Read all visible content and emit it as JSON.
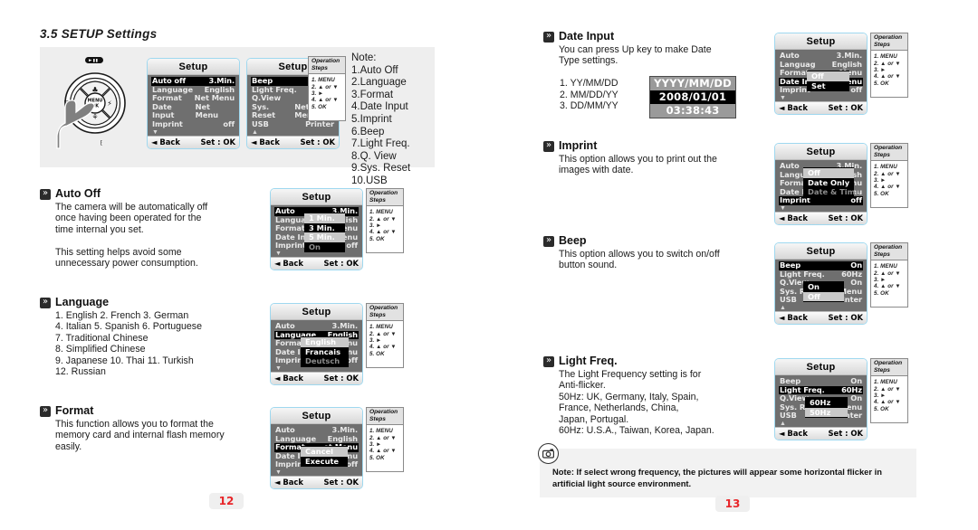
{
  "document": {
    "section_title": "3.5 SETUP Settings",
    "left_page_number": "12",
    "right_page_number": "13"
  },
  "ops_box": {
    "head_line1": "Operation",
    "head_line2": "Steps",
    "lines": [
      "1. MENU",
      "2. ▲ or ▼",
      "3. ►",
      "4. ▲ or ▼",
      "5. OK"
    ]
  },
  "lcd": {
    "title": "Setup",
    "back_label": "◄ Back",
    "set_label": "Set : OK",
    "down_arrow": "▼",
    "up_arrow": "▲"
  },
  "hero": {
    "note_heading": "Note:",
    "note_items": [
      "1.Auto Off",
      "2.Language",
      "3.Format",
      "4.Date Input",
      "5.Imprint",
      "6.Beep",
      "7.Light Freq.",
      "8.Q. View",
      "9.Sys. Reset",
      "10.USB"
    ],
    "screen_a": {
      "rows": [
        {
          "label": "Auto off",
          "value": "3.Min.",
          "selected": true
        },
        {
          "label": "Language",
          "value": "English",
          "selected": false
        },
        {
          "label": "Format",
          "value": "Net Menu",
          "selected": false
        },
        {
          "label": "Date Input",
          "value": "Net Menu",
          "selected": false
        },
        {
          "label": "Imprint",
          "value": "off",
          "selected": false
        }
      ],
      "scroll": "down"
    },
    "screen_b": {
      "rows": [
        {
          "label": "Beep",
          "value": "On",
          "selected": true
        },
        {
          "label": "Light Freq.",
          "value": "60Hz",
          "selected": false
        },
        {
          "label": "Q.View",
          "value": "On",
          "selected": false
        },
        {
          "label": "Sys. Reset",
          "value": "Net Menu",
          "selected": false
        },
        {
          "label": "USB",
          "value": "Printer",
          "selected": false
        }
      ],
      "scroll": "up"
    }
  },
  "sections": {
    "auto_off": {
      "title": "Auto Off",
      "body": "The camera will be automatically off\nonce having been operated for the\n time internal you set.\n\nThis setting helps avoid some\nunnecessary power consumption.",
      "rows": [
        {
          "label": "Auto",
          "value": "3.Min.",
          "selected": true
        },
        {
          "label": "Langua",
          "value": "nglish",
          "selected": false
        },
        {
          "label": "Format",
          "value": " Menu",
          "selected": false
        },
        {
          "label": "Date In",
          "value": "Menu",
          "selected": false
        },
        {
          "label": "Imprint",
          "value": "off",
          "selected": false
        }
      ],
      "submenu": [
        {
          "text": "1 Min.",
          "state": "hl"
        },
        {
          "text": "3 Min.",
          "state": "on"
        },
        {
          "text": "5 Min.",
          "state": "hl"
        },
        {
          "text": "On",
          "state": "dim"
        }
      ]
    },
    "language": {
      "title": "Language",
      "body": "1. English  2. French    3. German\n4. Italian     5. Spanish  6. Portuguese\n7. Traditional Chinese\n8. Simplified Chinese\n9. Japanese   10. Thai  11. Turkish\n12. Russian",
      "rows": [
        {
          "label": "Auto",
          "value": "3.Min.",
          "selected": false
        },
        {
          "label": "Language",
          "value": "English",
          "selected": true
        },
        {
          "label": "Format",
          "value": "lenu",
          "selected": false
        },
        {
          "label": "Date Inp",
          "value": "lenu",
          "selected": false
        },
        {
          "label": "Imprint",
          "value": "off",
          "selected": false
        }
      ],
      "submenu": [
        {
          "text": "English",
          "state": "hl"
        },
        {
          "text": "Francais",
          "state": "on"
        },
        {
          "text": "Deutsch",
          "state": "dim"
        }
      ]
    },
    "format": {
      "title": "Format",
      "body": "This function allows you to format the\nmemory card and internal flash memory\neasily.",
      "rows": [
        {
          "label": "Auto",
          "value": "3.Min.",
          "selected": false
        },
        {
          "label": "Language",
          "value": "English",
          "selected": false
        },
        {
          "label": "Format",
          "value": "et Menu",
          "selected": true
        },
        {
          "label": "Date In",
          "value": "Menu",
          "selected": false
        },
        {
          "label": "Imprint",
          "value": "off",
          "selected": false
        }
      ],
      "submenu": [
        {
          "text": "Cancel",
          "state": "hl"
        },
        {
          "text": "Execute",
          "state": "on"
        }
      ]
    },
    "date_input": {
      "title": "Date Input",
      "body": "You can press Up key to make Date\nType settings.",
      "types": [
        "1. YY/MM/DD",
        "2. MM/DD/YY",
        "3. DD/MM/YY"
      ],
      "date_box": {
        "format": "YYYY/MM/DD",
        "date": "2008/01/01",
        "time": "03:38:43"
      },
      "rows": [
        {
          "label": "Auto",
          "value": "3.Min.",
          "selected": false
        },
        {
          "label": "Languag",
          "value": "English",
          "selected": false
        },
        {
          "label": "Format",
          "value": " Menu",
          "selected": false
        },
        {
          "label": "Date In",
          "value": "Menu",
          "selected": true
        },
        {
          "label": "Imprint",
          "value": "off",
          "selected": false
        }
      ],
      "submenu": [
        {
          "text": "Off",
          "state": "hl"
        },
        {
          "text": "Set",
          "state": "on"
        }
      ]
    },
    "imprint": {
      "title": "Imprint",
      "body": "This option allows you to print out the\nimages with date.",
      "rows": [
        {
          "label": "Auto",
          "value": "3.Min.",
          "selected": false
        },
        {
          "label": "Langua",
          "value": "glish",
          "selected": false
        },
        {
          "label": "Format",
          "value": "Menu",
          "selected": false
        },
        {
          "label": "Date In",
          "value": "Menu",
          "selected": false
        },
        {
          "label": "Imprint",
          "value": "off",
          "selected": true
        }
      ],
      "submenu": [
        {
          "text": "Off",
          "state": "hl"
        },
        {
          "text": "Date Only",
          "state": "on"
        },
        {
          "text": "Date & Time",
          "state": "dim"
        }
      ]
    },
    "beep": {
      "title": "Beep",
      "body": "This option allows you to switch on/off\nbutton sound.",
      "rows": [
        {
          "label": "Beep",
          "value": "On",
          "selected": true
        },
        {
          "label": "Light Freq.",
          "value": "60Hz",
          "selected": false
        },
        {
          "label": "Q.View",
          "value": "On",
          "selected": false
        },
        {
          "label": "Sys. Re",
          "value": "Menu",
          "selected": false
        },
        {
          "label": "USB",
          "value": "rinter",
          "selected": false
        }
      ],
      "submenu": [
        {
          "text": "On",
          "state": "on"
        },
        {
          "text": "Off",
          "state": "hl"
        }
      ]
    },
    "light_freq": {
      "title": "Light Freq.",
      "body": "The Light Frequency setting is for\nAnti-flicker.\n50Hz: UK, Germany, Italy, Spain,\n          France, Netherlands, China,\n          Japan, Portugal.\n60Hz: U.S.A., Taiwan, Korea, Japan.",
      "rows": [
        {
          "label": "Beep",
          "value": "On",
          "selected": false
        },
        {
          "label": "Light Freq.",
          "value": "60Hz",
          "selected": true
        },
        {
          "label": "Q.View",
          "value": "On",
          "selected": false
        },
        {
          "label": "Sys. Re",
          "value": "Menu",
          "selected": false
        },
        {
          "label": "USB",
          "value": "rinter",
          "selected": false
        }
      ],
      "submenu": [
        {
          "text": "60Hz",
          "state": "on"
        },
        {
          "text": "50Hz",
          "state": "hl"
        }
      ]
    }
  },
  "note_bar": {
    "icon": "camera-icon",
    "text": "Note: If select wrong frequency, the pictures will appear some horizontal flicker in artificial light source environment."
  },
  "colors": {
    "lcd_border": "#9fd8ef",
    "lcd_list_bg": "#6f6f6f",
    "page_number": "#e8262a",
    "panel_bg": "#eeeeee"
  }
}
